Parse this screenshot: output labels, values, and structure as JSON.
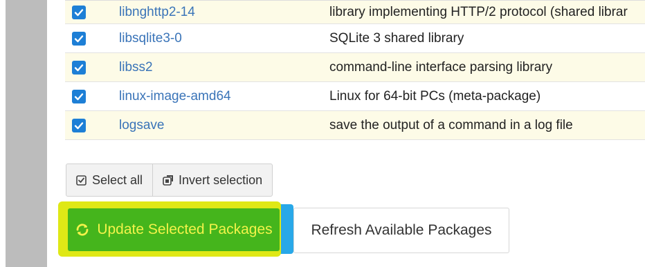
{
  "packages": [
    {
      "name": "libnghttp2-14",
      "description": "library implementing HTTP/2 protocol (shared librar",
      "checked": true
    },
    {
      "name": "libsqlite3-0",
      "description": "SQLite 3 shared library",
      "checked": true
    },
    {
      "name": "libss2",
      "description": "command-line interface parsing library",
      "checked": true
    },
    {
      "name": "linux-image-amd64",
      "description": "Linux for 64-bit PCs (meta-package)",
      "checked": true
    },
    {
      "name": "logsave",
      "description": "save the output of a command in a log file",
      "checked": true
    }
  ],
  "selection": {
    "select_all_label": "Select all",
    "invert_label": "Invert selection"
  },
  "actions": {
    "update_label": "Update Selected Packages",
    "refresh_label": "Refresh Available Packages"
  },
  "colors": {
    "checkbox": "#1d7fd6",
    "package_link": "#3a74b8",
    "update_button": "#45b51c",
    "update_text": "#f3f34a",
    "highlight_yellow": "#dfe816",
    "highlight_blue": "#29a8e8"
  },
  "icons": {
    "checkbox": "checkmark-icon",
    "select_all": "check-square-icon",
    "invert": "invert-selection-icon",
    "update": "refresh-arrows-icon"
  }
}
